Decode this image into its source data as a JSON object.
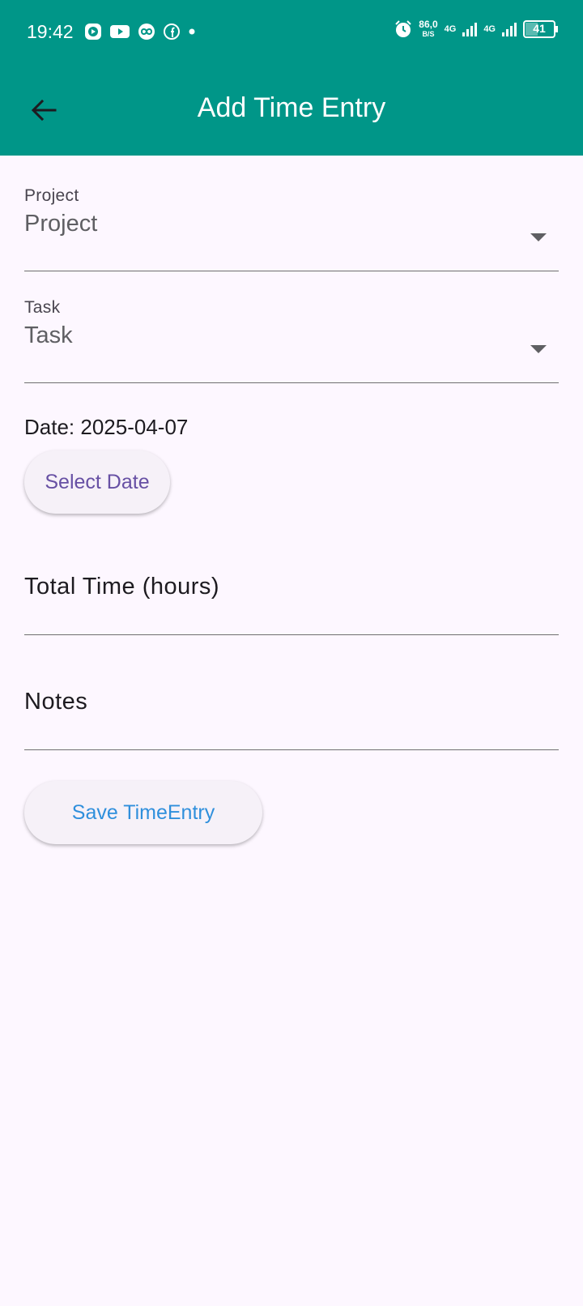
{
  "status_bar": {
    "time": "19:42",
    "speed_value": "86,0",
    "speed_unit": "B/S",
    "net1": "4G",
    "net2": "4G",
    "battery": "41"
  },
  "header": {
    "title": "Add Time Entry",
    "background": "#009688"
  },
  "form": {
    "project": {
      "label": "Project",
      "value": "Project"
    },
    "task": {
      "label": "Task",
      "value": "Task"
    },
    "date_text": "Date: 2025-04-07",
    "select_date_label": "Select Date",
    "total_time_placeholder": "Total Time (hours)",
    "notes_placeholder": "Notes",
    "save_label": "Save TimeEntry"
  },
  "colors": {
    "select_date_text": "#6750a4",
    "save_text": "#2f8fdc"
  }
}
